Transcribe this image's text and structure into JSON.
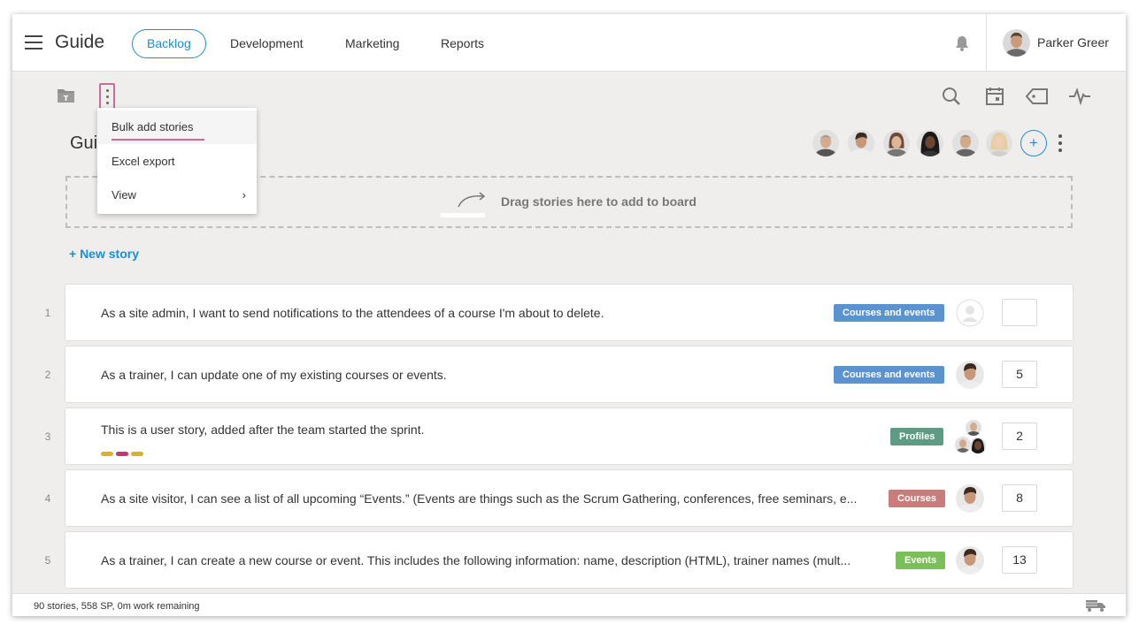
{
  "app": {
    "title": "Guide"
  },
  "nav": {
    "tabs": [
      {
        "label": "Backlog",
        "active": true
      },
      {
        "label": "Development",
        "active": false
      },
      {
        "label": "Marketing",
        "active": false
      },
      {
        "label": "Reports",
        "active": false
      }
    ]
  },
  "user": {
    "name": "Parker Greer"
  },
  "menu": {
    "items": [
      "Bulk add stories",
      "Excel export",
      "View"
    ],
    "highlighted": "Bulk add stories"
  },
  "board": {
    "title_visible": "Gui"
  },
  "team": {
    "add_label": "+"
  },
  "dropzone": {
    "text": "Drag stories here to add to board"
  },
  "new_story_label": "+ New story",
  "stories": [
    {
      "num": "1",
      "title": "As a site admin, I want to send notifications to the attendees of a course I'm about to delete.",
      "tag": "Courses and events",
      "tag_color": "#5b93d1",
      "points": ""
    },
    {
      "num": "2",
      "title": "As a trainer, I can update one of my existing courses or events.",
      "tag": "Courses and events",
      "tag_color": "#5b93d1",
      "points": "5"
    },
    {
      "num": "3",
      "title": "This is a user story, added after the team started the sprint.",
      "tag": "Profiles",
      "tag_color": "#5e9b84",
      "points": "2",
      "dot_colors": [
        "#d6b428",
        "#c9336f",
        "#d6b428"
      ]
    },
    {
      "num": "4",
      "title": "As a site visitor, I can see a list of all upcoming “Events.” (Events are things such as the Scrum Gathering, conferences, free seminars, e...",
      "tag": "Courses",
      "tag_color": "#c97c7c",
      "points": "8"
    },
    {
      "num": "5",
      "title": "As a trainer, I can create a new course or event. This includes the following information: name, description (HTML), trainer names (mult...",
      "tag": "Events",
      "tag_color": "#7bbf5a",
      "points": "13"
    }
  ],
  "status": {
    "text": "90 stories, 558 SP, 0m work remaining"
  },
  "colors": {
    "accent": "#1a8fd6",
    "highlight": "#c96c95",
    "background": "#efeeed"
  }
}
